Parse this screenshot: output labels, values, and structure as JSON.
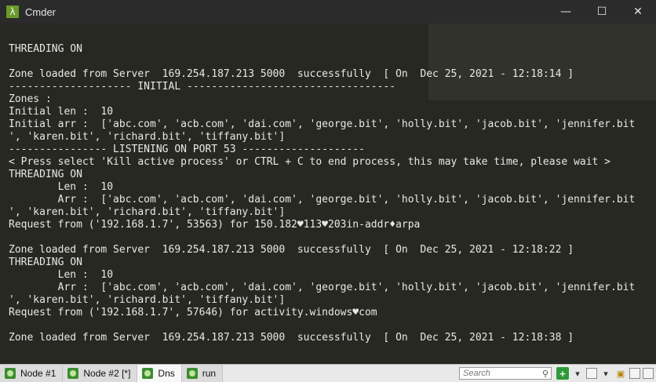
{
  "window": {
    "title": "Cmder",
    "minimize_glyph": "—",
    "maximize_glyph": "☐",
    "close_glyph": "✕"
  },
  "console": {
    "lines": [
      "THREADING ON",
      "",
      "Zone loaded from Server  169.254.187.213 5000  successfully  [ On  Dec 25, 2021 - 12:18:14 ]",
      "-------------------- INITIAL ----------------------------------",
      "Zones :",
      "Initial len :  10",
      "Initial arr :  ['abc.com', 'acb.com', 'dai.com', 'george.bit', 'holly.bit', 'jacob.bit', 'jennifer.bit",
      "', 'karen.bit', 'richard.bit', 'tiffany.bit']",
      "---------------- LISTENING ON PORT 53 --------------------",
      "< Press select 'Kill active process' or CTRL + C to end process, this may take time, please wait >",
      "THREADING ON",
      "        Len :  10",
      "        Arr :  ['abc.com', 'acb.com', 'dai.com', 'george.bit', 'holly.bit', 'jacob.bit', 'jennifer.bit",
      "', 'karen.bit', 'richard.bit', 'tiffany.bit']",
      "Request from ('192.168.1.7', 53563) for 150.182♥113♥203in-addr♦arpa",
      "",
      "Zone loaded from Server  169.254.187.213 5000  successfully  [ On  Dec 25, 2021 - 12:18:22 ]",
      "THREADING ON",
      "        Len :  10",
      "        Arr :  ['abc.com', 'acb.com', 'dai.com', 'george.bit', 'holly.bit', 'jacob.bit', 'jennifer.bit",
      "', 'karen.bit', 'richard.bit', 'tiffany.bit']",
      "Request from ('192.168.1.7', 57646) for activity.windows♥com",
      "",
      "Zone loaded from Server  169.254.187.213 5000  successfully  [ On  Dec 25, 2021 - 12:18:38 ]"
    ]
  },
  "tabs": [
    {
      "label": "Node #1",
      "active": false
    },
    {
      "label": "Node #2 [*]",
      "active": false
    },
    {
      "label": "Dns",
      "active": true
    },
    {
      "label": "run",
      "active": false
    }
  ],
  "toolbar": {
    "search_placeholder": "Search",
    "search_icon": "magnifier-icon",
    "add_icon": "plus-icon",
    "menu_icon": "dropdown-arrow-icon",
    "lock_icon": "lock-icon"
  }
}
